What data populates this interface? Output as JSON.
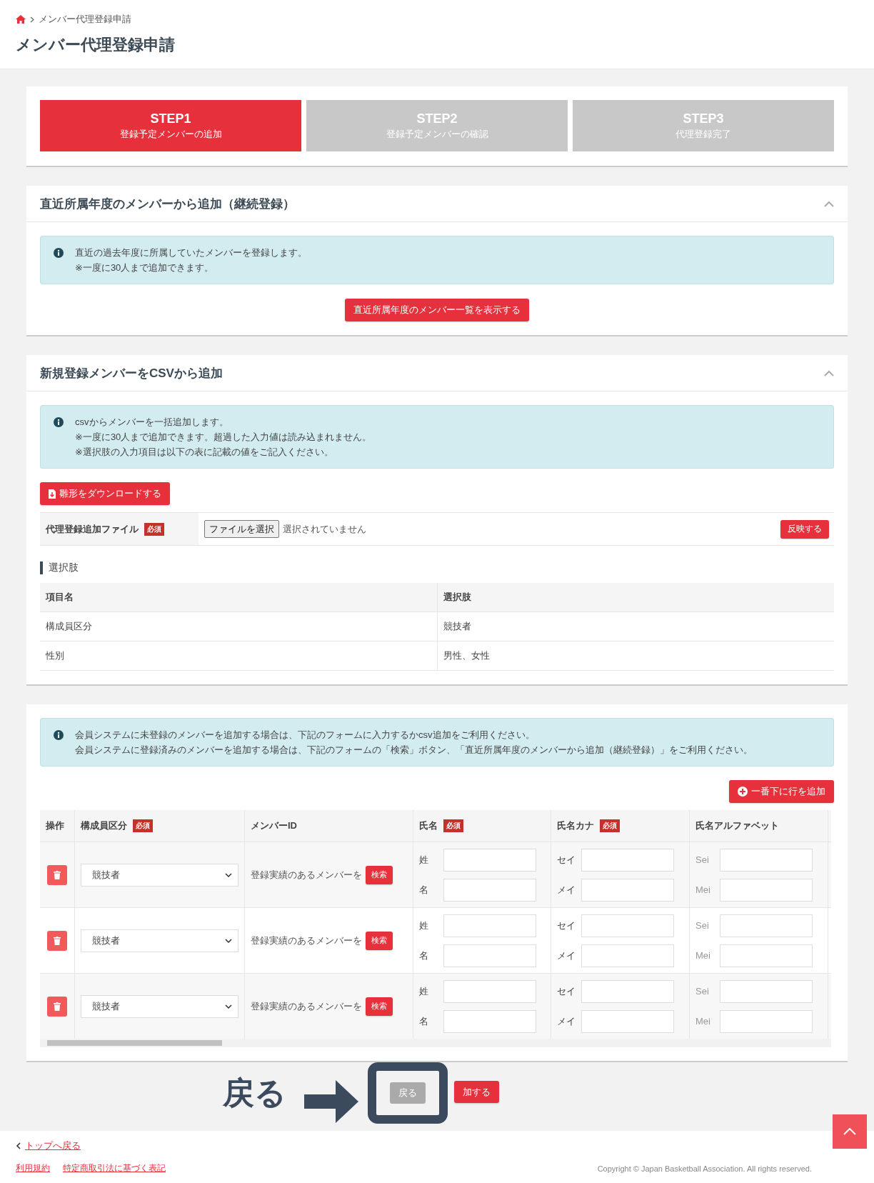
{
  "breadcrumb": {
    "items": [
      "メンバー代理登録申請"
    ]
  },
  "page_title": "メンバー代理登録申請",
  "steps": [
    {
      "label": "STEP1",
      "caption": "登録予定メンバーの追加",
      "selected": true
    },
    {
      "label": "STEP2",
      "caption": "登録予定メンバーの確認",
      "selected": false
    },
    {
      "label": "STEP3",
      "caption": "代理登録完了",
      "selected": false
    }
  ],
  "continuing_section": {
    "title": "直近所属年度のメンバーから追加（継続登録）",
    "expanded": true,
    "info": [
      "直近の過去年度に所属していたメンバーを登録します。",
      "※一度に30人まで追加できます。"
    ],
    "button": "直近所属年度のメンバー一覧を表示する"
  },
  "csv_section": {
    "title": "新規登録メンバーをCSVから追加",
    "expanded": true,
    "info": [
      "csvからメンバーを一括追加します。",
      "※一度に30人まで追加できます。超過した入力値は読み込まれません。",
      "※選択肢の入力項目は以下の表に記載の値をご記入ください。"
    ],
    "download_button": "雛形をダウンロードする",
    "file_field": {
      "label": "代理登録追加ファイル",
      "badge": "必須",
      "button": "ファイルを選択",
      "status": "選択されていません"
    },
    "apply_button": "反映する",
    "choices_heading": "選択肢",
    "choices_table": {
      "columns": [
        "項目名",
        "選択肢"
      ],
      "rows": [
        [
          "構成員区分",
          "競技者"
        ],
        [
          "性別",
          "男性、女性"
        ]
      ]
    }
  },
  "form_section": {
    "info": [
      "会員システムに未登録のメンバーを追加する場合は、下記のフォームに入力するかcsv追加をご利用ください。",
      "会員システムに登録済みのメンバーを追加する場合は、下記のフォームの「検索」ボタン、「直近所属年度のメンバーから追加（継続登録）」をご利用ください。"
    ],
    "add_row_button": "一番下に行を追加",
    "columns": [
      {
        "label": "操作"
      },
      {
        "label": "構成員区分",
        "badge": "必須"
      },
      {
        "label": "メンバーID"
      },
      {
        "label": "氏名",
        "badge": "必須"
      },
      {
        "label": "氏名カナ",
        "badge": "必須"
      },
      {
        "label": "氏名アルファベット"
      }
    ],
    "rows": [
      {
        "category": "競技者",
        "member_id_hint": "登録実績のあるメンバーを",
        "search_button": "検索",
        "name_labels": [
          "姓",
          "名"
        ],
        "kana_labels": [
          "セイ",
          "メイ"
        ],
        "alpha_labels": [
          "Sei",
          "Mei"
        ]
      },
      {
        "category": "競技者",
        "member_id_hint": "登録実績のあるメンバーを",
        "search_button": "検索",
        "name_labels": [
          "姓",
          "名"
        ],
        "kana_labels": [
          "セイ",
          "メイ"
        ],
        "alpha_labels": [
          "Sei",
          "Mei"
        ]
      },
      {
        "category": "競技者",
        "member_id_hint": "登録実績のあるメンバーを",
        "search_button": "検索",
        "name_labels": [
          "姓",
          "名"
        ],
        "kana_labels": [
          "セイ",
          "メイ"
        ],
        "alpha_labels": [
          "Sei",
          "Mei"
        ]
      }
    ]
  },
  "actions": {
    "back_button": "戻る",
    "submit_button": "加する"
  },
  "annotation": {
    "label": "戻る"
  },
  "footer": {
    "back_link": "トップへ戻る",
    "links": [
      "利用規約",
      "特定商取引法に基づく表記"
    ],
    "copyright": "Copyright © Japan Basketball Association. All rights reserved."
  }
}
